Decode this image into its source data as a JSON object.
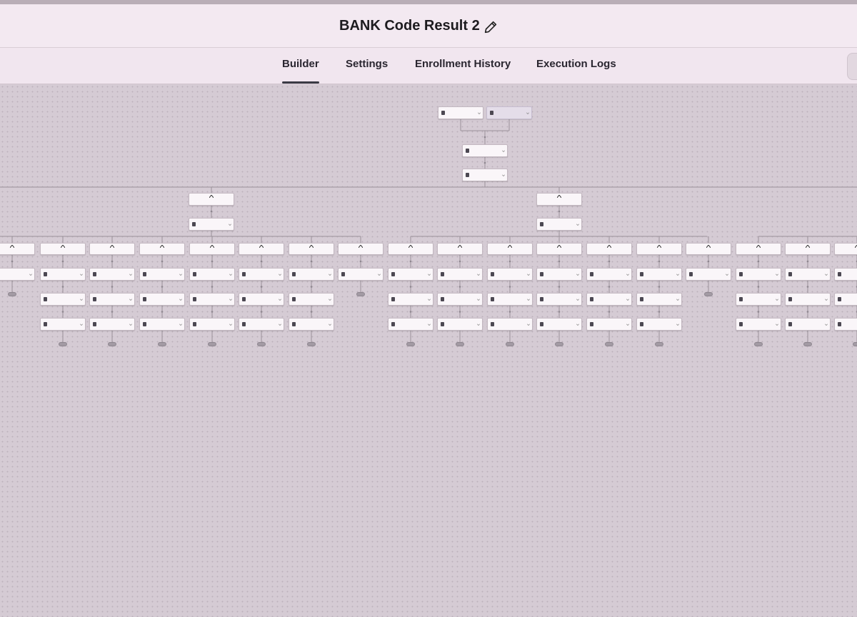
{
  "header": {
    "title": "BANK Code Result 2"
  },
  "tabs": [
    {
      "label": "Builder",
      "active": true
    },
    {
      "label": "Settings",
      "active": false
    },
    {
      "label": "Enrollment History",
      "active": false
    },
    {
      "label": "Execution Logs",
      "active": false
    }
  ],
  "colors": {
    "canvas": "#d5cbd4",
    "header": "#f3e9f1",
    "node": "#faf6f9",
    "edge": "#9a929a"
  },
  "icons": [
    "pencil-icon",
    "trigger-icon",
    "branch-icon",
    "action-icon",
    "end-icon"
  ]
}
